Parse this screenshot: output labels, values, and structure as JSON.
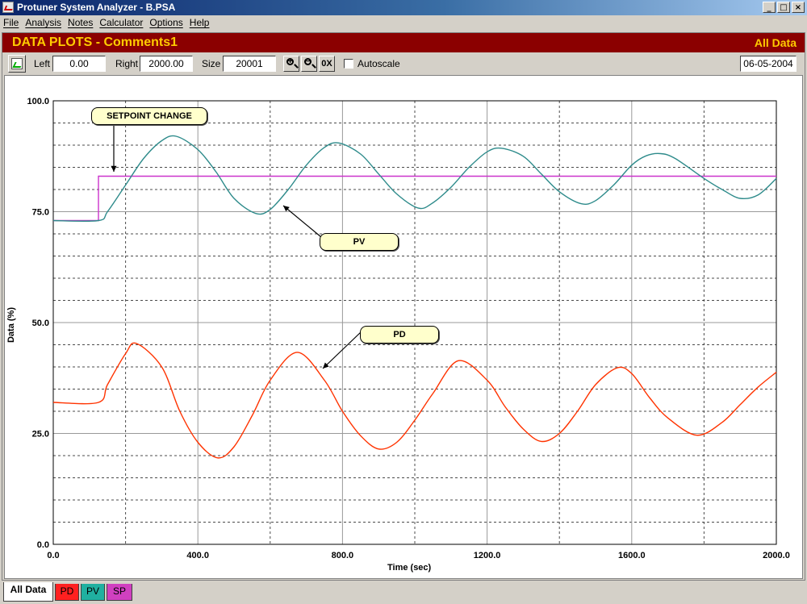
{
  "window": {
    "title": "Protuner System Analyzer - B.PSA",
    "min": "_",
    "max": "□",
    "close": "×"
  },
  "menu": [
    "File",
    "Analysis",
    "Notes",
    "Calculator",
    "Options",
    "Help"
  ],
  "header": {
    "title": "DATA PLOTS - Comments1",
    "scope": "All Data"
  },
  "toolbar": {
    "left_label": "Left",
    "left_value": "0.00",
    "right_label": "Right",
    "right_value": "2000.00",
    "size_label": "Size",
    "size_value": "20001",
    "zoom_in": "+",
    "zoom_out": "−",
    "zoom_reset": "0X",
    "autoscale_label": "Autoscale",
    "date": "06-05-2004"
  },
  "annotations": {
    "setpoint": "SETPOINT CHANGE",
    "pv": "PV",
    "pd": "PD"
  },
  "tabs": [
    {
      "label": "All Data",
      "color": "#ffffff"
    },
    {
      "label": "PD",
      "color": "#ff2020"
    },
    {
      "label": "PV",
      "color": "#20b0a0"
    },
    {
      "label": "SP",
      "color": "#d040c0"
    }
  ],
  "colors": {
    "pv": "#2e8b8b",
    "pd": "#ff3300",
    "sp": "#cc33cc",
    "header_bg": "#8b0000",
    "header_text": "#ffcc00"
  },
  "chart_data": {
    "type": "line",
    "xlabel": "Time (sec)",
    "ylabel": "Data (%)",
    "xlim": [
      0,
      2000
    ],
    "ylim": [
      0,
      100
    ],
    "x_ticks": [
      "0.0",
      "400.0",
      "800.0",
      "1200.0",
      "1600.0",
      "2000.0"
    ],
    "y_ticks": [
      "0.0",
      "25.0",
      "50.0",
      "75.0",
      "100.0"
    ],
    "grid": true,
    "series": [
      {
        "name": "SP",
        "x": [
          0,
          125,
          125,
          2000
        ],
        "y": [
          73,
          73,
          83,
          83
        ]
      },
      {
        "name": "PV",
        "x": [
          0,
          125,
          150,
          200,
          250,
          300,
          340,
          400,
          450,
          500,
          560,
          600,
          650,
          700,
          750,
          790,
          850,
          900,
          950,
          1010,
          1050,
          1100,
          1150,
          1200,
          1240,
          1300,
          1350,
          1400,
          1460,
          1500,
          1550,
          1600,
          1640,
          1680,
          1720,
          1800,
          1850,
          1900,
          1950,
          2000
        ],
        "y": [
          73,
          73,
          75,
          81,
          87,
          91,
          92,
          89,
          84,
          78,
          74.6,
          75.5,
          80,
          85.5,
          89.5,
          90.5,
          88,
          83.5,
          79,
          75.8,
          77,
          80.5,
          85,
          88.5,
          89.3,
          87.5,
          83.5,
          79.5,
          76.8,
          77.5,
          81,
          85.5,
          87.6,
          88.1,
          87,
          82.5,
          80,
          78,
          78.8,
          82.5
        ]
      },
      {
        "name": "PD",
        "x": [
          0,
          125,
          150,
          200,
          230,
          300,
          350,
          400,
          455,
          500,
          550,
          600,
          675,
          750,
          800,
          850,
          900,
          950,
          1000,
          1050,
          1120,
          1200,
          1250,
          1300,
          1350,
          1400,
          1450,
          1500,
          1560,
          1600,
          1650,
          1700,
          1780,
          1850,
          1900,
          1950,
          2000
        ],
        "y": [
          32,
          32,
          36,
          43,
          45.3,
          40,
          30,
          23,
          19.5,
          22,
          29,
          37,
          43.3,
          37,
          30,
          24.5,
          21.5,
          23,
          28,
          34,
          41.4,
          37,
          31,
          26,
          23.2,
          25,
          30,
          36,
          39.8,
          38.5,
          33,
          28.5,
          24.6,
          27.5,
          31.5,
          35.5,
          38.8
        ]
      }
    ]
  }
}
